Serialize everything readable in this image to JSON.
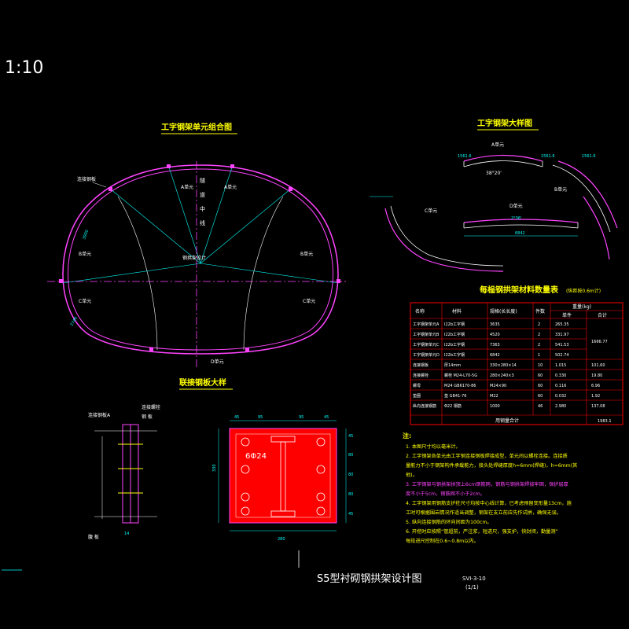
{
  "colors": {
    "background": "#000000",
    "outline": "#ff44ff",
    "text_yellow": "#ffff00",
    "text_white": "#ffffff",
    "cyan": "#00ffff",
    "table_border": "#ff0000"
  },
  "scale": "1:10",
  "drawing_title": "S5型衬砌钢拱架设计图",
  "drawing_number": "SVI-3-10",
  "sheet": "(1/1)",
  "combination": {
    "title": "工字钢架单元组合图",
    "label_weld": "连接钢板",
    "label_tunnel": "隧",
    "label_tunnel2": "道",
    "label_tunnel3": "中",
    "label_tunnel4": "线",
    "unit_a": "A单元",
    "unit_a2": "A单元",
    "unit_b_left": "B单元",
    "unit_b_right": "B单元",
    "unit_c_left": "C单元",
    "unit_c_right": "C单元",
    "unit_d": "D单元",
    "spring_line": "钢拱架设计",
    "dim_left": "3900",
    "dim_left2": "2740"
  },
  "large_sample": {
    "title": "工字钢架大样图",
    "unit_a": "A单元",
    "unit_b": "B单元",
    "unit_c": "C单元",
    "unit_d": "D单元",
    "dim_a": "38°20'",
    "dim_d": "2°36'",
    "dim1": "1561.6",
    "dim2": "1561.6",
    "dim3": "6842",
    "dim4": "1561.6"
  },
  "plate": {
    "title": "联接钢板大样",
    "label_plate": "连接钢板A",
    "label_bolt": "连接螺栓",
    "label_steel": "钢 板",
    "label_web": "腹 板",
    "hole_spec": "6Φ24",
    "dim_w": "280",
    "dim_h": "330",
    "dims_top": [
      "45",
      "95",
      "95",
      "45"
    ],
    "dims_right": [
      "45",
      "80",
      "80",
      "80",
      "45"
    ],
    "dim_t": "14"
  },
  "table": {
    "title": "每榀钢拱架材料数量表",
    "subtitle": "(纵距按0.6m计)",
    "headers": [
      "名称",
      "材料",
      "规格(长长度)",
      "件数",
      "重量(kg)"
    ],
    "subheaders": [
      "单件",
      "合计"
    ],
    "rows": [
      [
        "工字钢架单元A",
        "I22b工字钢",
        "3635",
        "2",
        "265.35",
        ""
      ],
      [
        "工字钢架单元B",
        "I22b工字钢",
        "4520",
        "2",
        "331.97",
        ""
      ],
      [
        "工字钢架单元C",
        "I22b工字钢",
        "7363",
        "2",
        "541.53",
        ""
      ],
      [
        "工字钢架单元D",
        "I22b工字钢",
        "6842",
        "1",
        "502.74",
        ""
      ],
      [
        "连接钢板",
        "厚14mm",
        "330×280×14",
        "10",
        "1.015",
        "101.60"
      ],
      [
        "连接螺栓",
        "螺栓 M24-L70-5G",
        "280×240×3",
        "60",
        "0.330",
        "19.80"
      ],
      [
        "螺母",
        "M24 GB6170-86",
        "M24×90",
        "60",
        "0.116",
        "6.96"
      ],
      [
        "垫圈",
        "垫 GB41-76",
        "M22",
        "60",
        "0.032",
        "1.92"
      ],
      [
        "纵向连接钢筋",
        "Φ22 钢筋",
        "1000",
        "46",
        "2.980",
        "137.08"
      ]
    ],
    "subtotal": "1666.77",
    "total_label": "用钢量合计",
    "total": "1983.1"
  },
  "notes": {
    "title": "注:",
    "items": [
      "1. 本图尺寸均以毫米计。",
      "2. 工字钢架各单元由工字钢连接钢板焊接成型，单元间以螺栓连接。连接质",
      "   量能力不小于钢架构件承载能力，接头处焊缝厚度h=6mm(焊缝)，h=6mm(其",
      "   他)。",
      "3. 工字钢架与钢拱架拱顶上6cm钢筋网，钢筋与钢拱架焊接牢固，保护层厚",
      "   度不小于5cm，钢筋网不小于2cm。",
      "4. 工字钢架用钢筋支护柱尺寸均按中心线计算，已考虑预留变形量13cm，施",
      "   工时可根据围岩情况作适当调整，钢架在支立前应先作试拼，确保无误。",
      "5. 纵向连接钢筋的环向间距为100cm。",
      "6. 开挖时应按照“管超前，严注浆，短进尺，强支护，快封闭，勤量测”",
      "   每段进尺控制在0.6~0.8m以内。"
    ]
  }
}
